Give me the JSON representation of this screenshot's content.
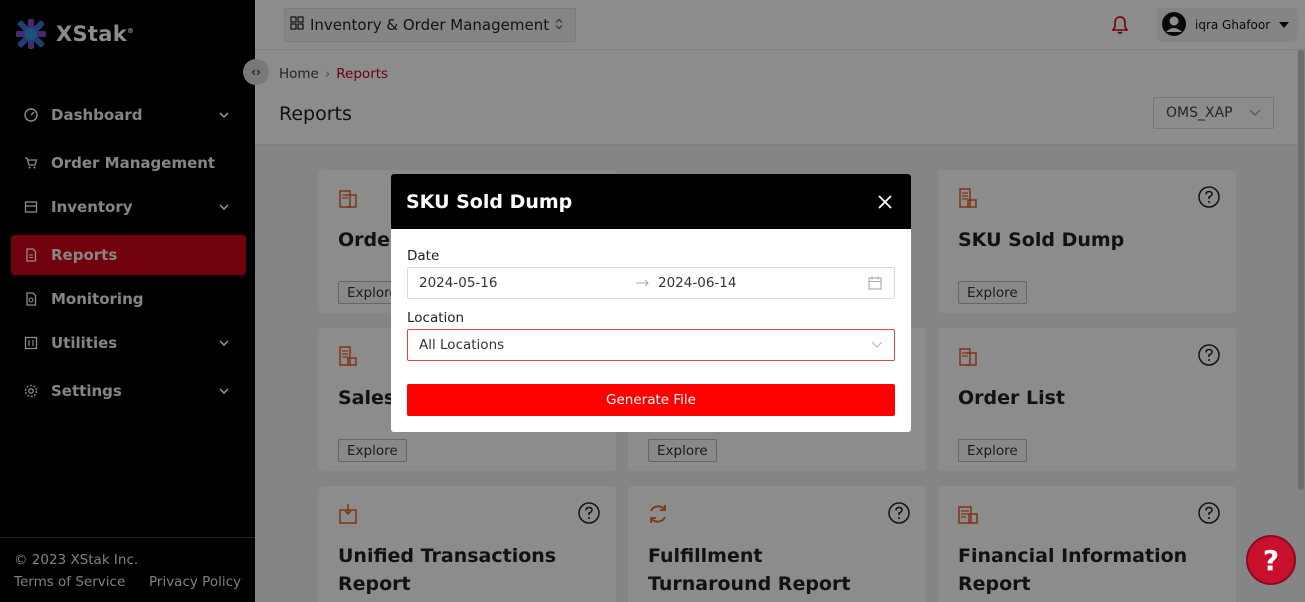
{
  "brand": {
    "name": "XStak",
    "mark": "®"
  },
  "sidebar": {
    "items": [
      {
        "label": "Dashboard",
        "icon": "dashboard-icon",
        "has_chevron": true
      },
      {
        "label": "Order Management",
        "icon": "cart-icon",
        "has_chevron": false
      },
      {
        "label": "Inventory",
        "icon": "inventory-icon",
        "has_chevron": true
      },
      {
        "label": "Reports",
        "icon": "report-icon",
        "has_chevron": false,
        "active": true
      },
      {
        "label": "Monitoring",
        "icon": "monitoring-icon",
        "has_chevron": false
      },
      {
        "label": "Utilities",
        "icon": "utilities-icon",
        "has_chevron": true
      },
      {
        "label": "Settings",
        "icon": "gear-icon",
        "has_chevron": true
      }
    ],
    "footer": {
      "copyright": "© 2023 XStak Inc.",
      "terms": "Terms of Service",
      "privacy": "Privacy Policy"
    }
  },
  "topbar": {
    "module": "Inventory & Order Management",
    "user_name": "iqra Ghafoor"
  },
  "header": {
    "breadcrumb": {
      "home": "Home",
      "current": "Reports"
    },
    "title": "Reports",
    "store_select": "OMS_XAP"
  },
  "cards": [
    {
      "title": "Order",
      "explore": "Explore"
    },
    {
      "title": "SKU Sold Dump",
      "explore": "Explore"
    },
    {
      "title": "Sales",
      "explore": "Explore"
    },
    {
      "title": "",
      "explore": "Explore"
    },
    {
      "title": "Order List",
      "explore": "Explore"
    },
    {
      "title": "Unified Transactions Report"
    },
    {
      "title": "Fulfillment Turnaround Report"
    },
    {
      "title": "Financial Information Report"
    }
  ],
  "modal": {
    "title": "SKU Sold Dump",
    "date_label": "Date",
    "date_from": "2024-05-16",
    "date_to": "2024-06-14",
    "location_label": "Location",
    "location_value": "All Locations",
    "generate_label": "Generate File"
  },
  "help_fab": "?",
  "colors": {
    "accent": "#d0021b",
    "button": "#ff0000",
    "icon_orange": "#e8612c"
  }
}
